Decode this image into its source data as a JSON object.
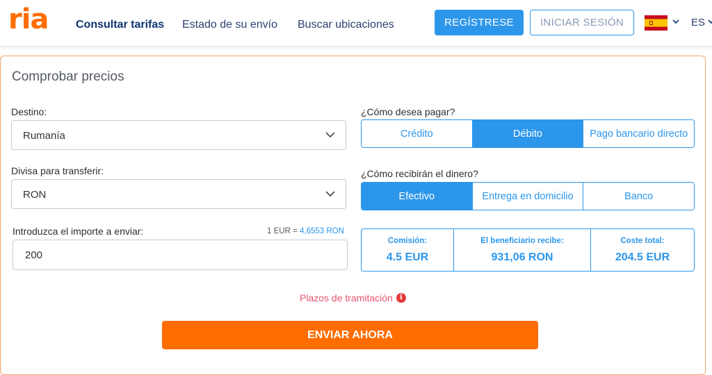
{
  "header": {
    "logo": "ria",
    "nav": [
      "Consultar tarifas",
      "Estado de su envío",
      "Buscar ubicaciones"
    ],
    "register_label": "REGÍSTRESE",
    "login_label": "INICIAR SESIÓN",
    "language": "ES"
  },
  "form": {
    "title": "Comprobar precios",
    "destination_label": "Destino:",
    "destination_value": "Rumanía",
    "currency_label": "Divisa para transferir:",
    "currency_value": "RON",
    "amount_label": "Introduzca el importe a enviar:",
    "rate_prefix": "1 EUR = ",
    "rate_value": "4,6553 RON",
    "amount_value": "200",
    "pay_label": "¿Cómo desea pagar?",
    "pay_options": [
      "Crédito",
      "Débito",
      "Pago bancario directo"
    ],
    "receive_label": "¿Cómo recibirán el dinero?",
    "receive_options": [
      "Efectivo",
      "Entrega en domicilio",
      "Banco"
    ],
    "summary": [
      {
        "label": "Comisión:",
        "value": "4.5 EUR"
      },
      {
        "label": "El beneficiario recibe:",
        "value": "931,06 RON"
      },
      {
        "label": "Coste total:",
        "value": "204.5 EUR"
      }
    ],
    "timing_label": "Plazos de tramitación",
    "send_label": "ENVIAR AHORA"
  },
  "colors": {
    "brand_orange": "#ff6c00",
    "accent_blue": "#2c96ea",
    "nav_navy": "#0d3472",
    "warning_pink": "#e8536e"
  },
  "icons": [
    "chevron-down-icon",
    "spain-flag-icon",
    "info-icon"
  ]
}
